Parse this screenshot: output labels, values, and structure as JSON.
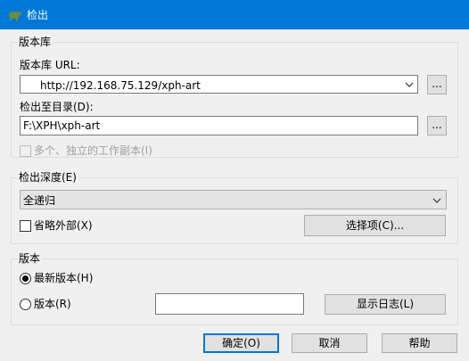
{
  "window": {
    "title": "检出",
    "icon": "tortoise-icon"
  },
  "repository": {
    "group_label": "版本库",
    "url_label": "版本库 URL:",
    "url_value": "http://192.168.75.129/xph-art",
    "browse_label": "...",
    "dir_label": "检出至目录(D):",
    "dir_value": "F:\\XPH\\xph-art",
    "dir_browse_label": "...",
    "multi_copy_label": "多个、独立的工作副本(I)"
  },
  "depth": {
    "group_label": "检出深度(E)",
    "selected": "全递归",
    "omit_externals_label": "省略外部(X)",
    "choose_items_label": "选择项(C)..."
  },
  "revision": {
    "group_label": "版本",
    "head_label": "最新版本(H)",
    "specific_label": "版本(R)",
    "revision_value": "",
    "show_log_label": "显示日志(L)"
  },
  "buttons": {
    "ok": "确定(O)",
    "cancel": "取消",
    "help": "帮助"
  }
}
